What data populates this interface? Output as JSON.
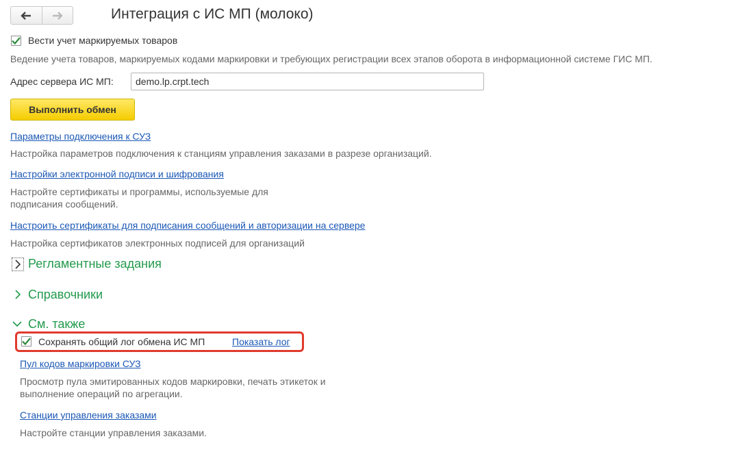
{
  "nav": {
    "back_icon": "arrow-left-icon",
    "forward_icon": "arrow-right-icon"
  },
  "page_title": "Интеграция с ИС МП (молоко)",
  "tracking": {
    "checkbox_label": "Вести учет маркируемых товаров",
    "checked": true,
    "description": "Ведение учета товаров, маркируемых кодами маркировки и требующих регистрации всех этапов оборота в информационной системе ГИС МП."
  },
  "server": {
    "label": "Адрес сервера ИС МП:",
    "value": "demo.lp.crpt.tech"
  },
  "exchange_button": "Выполнить обмен",
  "links": [
    {
      "text": "Параметры подключения к СУЗ",
      "description": "Настройка параметров подключения к станциям управления заказами в разрезе организаций."
    },
    {
      "text": "Настройки электронной подписи и шифрования",
      "description_lines": [
        "Настройте сертификаты и программы, используемые для",
        "подписания сообщений."
      ]
    },
    {
      "text": "Настроить сертификаты для подписания сообщений и авторизации на сервере",
      "description": "Настройка сертификатов электронных подписей для организаций"
    }
  ],
  "sections": {
    "scheduled": "Регламентные задания",
    "catalogs": "Справочники",
    "see_also": "См. также"
  },
  "see_also": {
    "log_checkbox_label": "Сохранять общий лог обмена ИС МП",
    "log_checked": true,
    "show_log_link": "Показать лог",
    "items": [
      {
        "text": "Пул кодов маркировки СУЗ",
        "description_lines": [
          "Просмотр пула эмитированных кодов маркировки, печать этикеток и",
          "выполнение операций по агрегации."
        ]
      },
      {
        "text": "Станции управления заказами",
        "description": "Настройте станции управления заказами."
      }
    ]
  },
  "colors": {
    "accent_green": "#229a4c",
    "link_blue": "#1a57b5",
    "button_yellow": "#f5cd00",
    "highlight_red": "#e03a2d"
  }
}
